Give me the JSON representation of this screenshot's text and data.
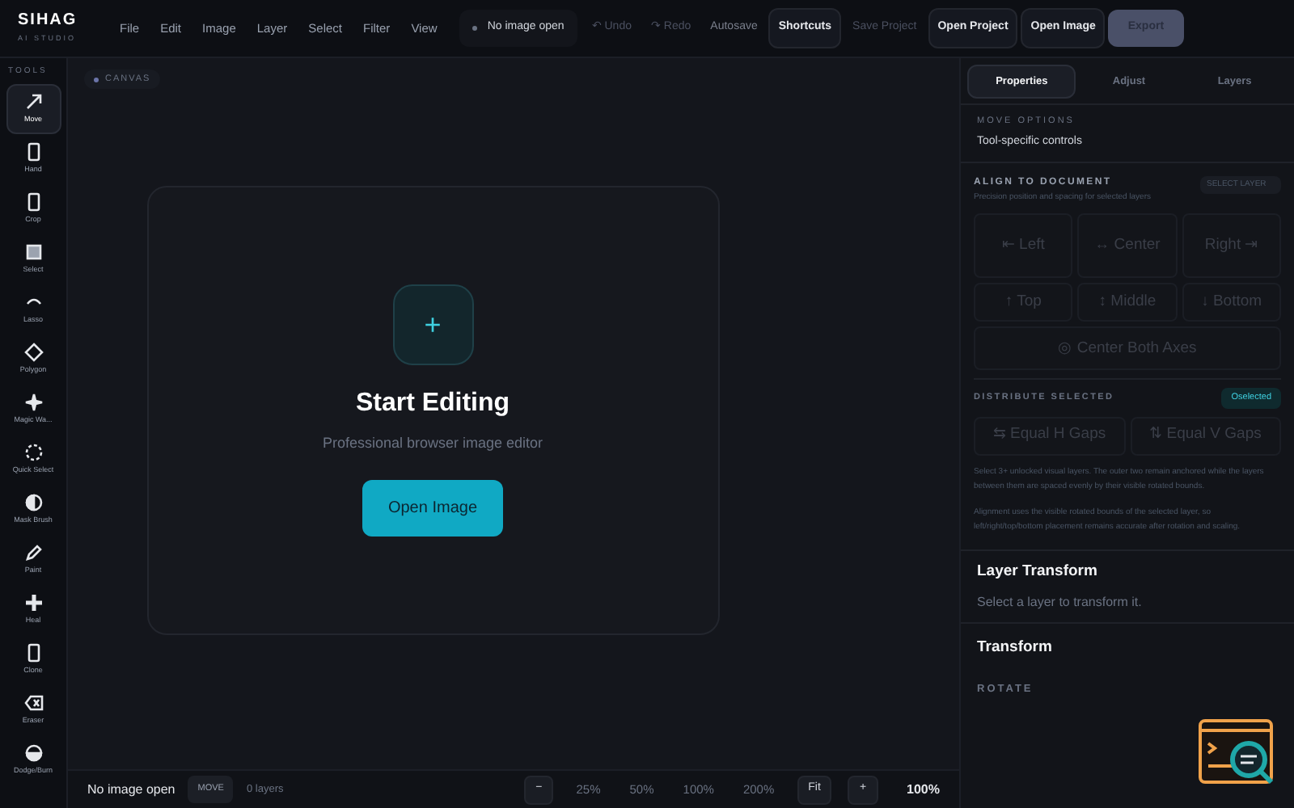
{
  "brand": {
    "name": "SIHAG",
    "tagline": "AI STUDIO"
  },
  "menu": [
    "File",
    "Edit",
    "Image",
    "Layer",
    "Select",
    "Filter",
    "View"
  ],
  "status_chip": "No image open",
  "actions": [
    {
      "kind": "text",
      "label": "↶ Undo",
      "disabled": true
    },
    {
      "kind": "text",
      "label": "↷ Redo",
      "disabled": true
    },
    {
      "kind": "note",
      "label": "Autosave",
      "disabled": false
    },
    {
      "kind": "button",
      "label": "Shortcuts",
      "disabled": false
    },
    {
      "kind": "text",
      "label": "Save Project",
      "disabled": true
    },
    {
      "kind": "button",
      "label": "Open Project",
      "disabled": false
    },
    {
      "kind": "button",
      "label": "Open Image",
      "disabled": false
    },
    {
      "kind": "primary",
      "label": "Export",
      "disabled": true
    }
  ],
  "tools_heading": "TOOLS",
  "tools": [
    {
      "label": "Move",
      "selected": true
    },
    {
      "label": "Hand",
      "selected": false
    },
    {
      "label": "Crop",
      "selected": false
    },
    {
      "label": "Select",
      "selected": false
    },
    {
      "label": "Lasso",
      "selected": false
    },
    {
      "label": "Polygon",
      "selected": false
    },
    {
      "label": "Magic Wa...",
      "selected": false
    },
    {
      "label": "Quick Select",
      "selected": false
    },
    {
      "label": "Mask Brush",
      "selected": false
    },
    {
      "label": "Paint",
      "selected": false
    },
    {
      "label": "Heal",
      "selected": false
    },
    {
      "label": "Clone",
      "selected": false
    },
    {
      "label": "Eraser",
      "selected": false
    },
    {
      "label": "Dodge/Burn",
      "selected": false
    }
  ],
  "canvas": {
    "badge": "CANVAS",
    "plus": "+",
    "title": "Start Editing",
    "subtitle": "Professional browser image editor",
    "button": "Open Image"
  },
  "status_bar": {
    "text": "No image open",
    "tool": "MOVE",
    "layers": "0 layers",
    "zoom": [
      {
        "label": "−",
        "kind": "button"
      },
      {
        "label": "25%",
        "kind": "text"
      },
      {
        "label": "50%",
        "kind": "text"
      },
      {
        "label": "100%",
        "kind": "text"
      },
      {
        "label": "200%",
        "kind": "text"
      },
      {
        "label": "Fit",
        "kind": "button"
      },
      {
        "label": "+",
        "kind": "button"
      }
    ],
    "current": "100%"
  },
  "panel": {
    "tabs": [
      {
        "label": "Properties",
        "selected": true
      },
      {
        "label": "Adjust",
        "selected": false
      },
      {
        "label": "Layers",
        "selected": false
      }
    ],
    "move_options": {
      "heading": "MOVE OPTIONS",
      "text": "Tool-specific controls"
    },
    "align": {
      "heading": "ALIGN TO DOCUMENT",
      "text": "Precision position and spacing for selected layers",
      "badge": "SELECT LAYER",
      "buttons": [
        {
          "label": "⇤ Left",
          "disabled": true
        },
        {
          "label": "↔ Center",
          "disabled": true
        },
        {
          "label": "Right ⇥",
          "disabled": true
        },
        {
          "label": "↑ Top",
          "disabled": true
        },
        {
          "label": "↕ Middle",
          "disabled": true
        },
        {
          "label": "↓ Bottom",
          "disabled": true
        }
      ],
      "wide_button": {
        "label": "◎ Center Both Axes",
        "disabled": true
      }
    },
    "distribute": {
      "heading": "DISTRIBUTE SELECTED",
      "badge": "Oselected",
      "buttons": [
        {
          "label": "⇆ Equal H Gaps",
          "disabled": true
        },
        {
          "label": "⇅ Equal V Gaps",
          "disabled": true
        }
      ],
      "notes": [
        "Select 3+ unlocked visual layers. The outer two remain anchored while the layers between them are spaced evenly by their visible rotated bounds.",
        "Alignment uses the visible rotated bounds of the selected layer, so left/right/top/bottom placement remains accurate after rotation and scaling."
      ]
    },
    "layer_transform": {
      "title": "Layer Transform",
      "text": "Select a layer to transform it."
    },
    "transform": {
      "title": "Transform",
      "label": "ROTATE"
    }
  }
}
